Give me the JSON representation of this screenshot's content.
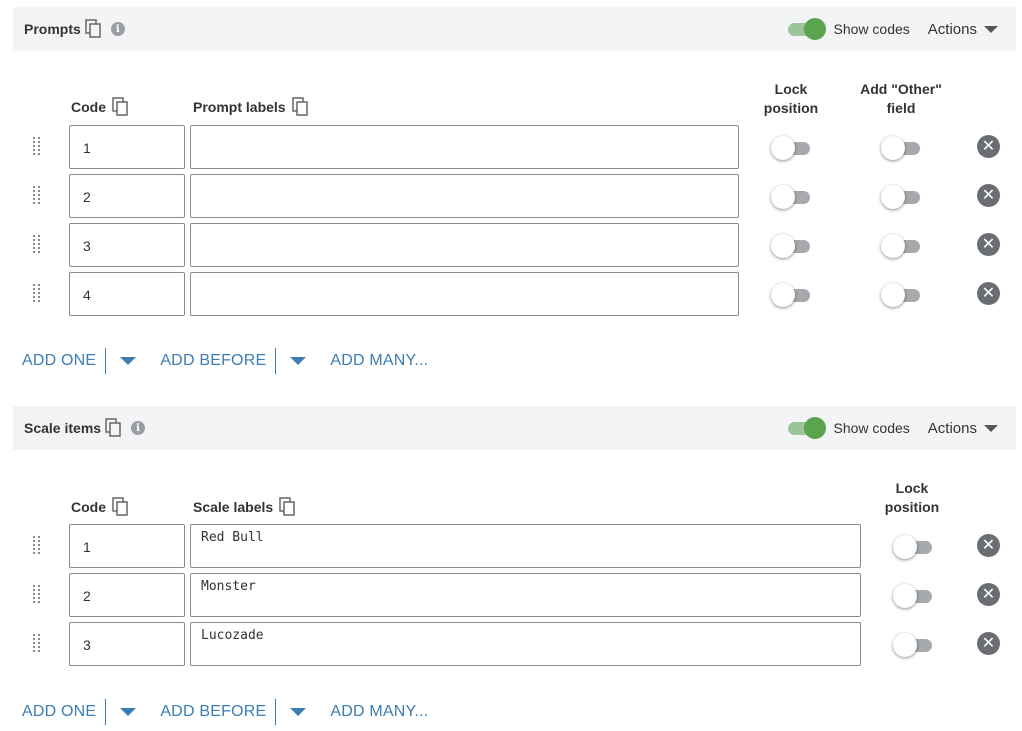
{
  "prompts": {
    "title": "Prompts",
    "show_codes": "Show codes",
    "actions": "Actions",
    "col_code": "Code",
    "col_labels": "Prompt labels",
    "col_lock_1": "Lock",
    "col_lock_2": "position",
    "col_other_1": "Add \"Other\"",
    "col_other_2": "field",
    "rows": [
      {
        "code": "1",
        "label": ""
      },
      {
        "code": "2",
        "label": ""
      },
      {
        "code": "3",
        "label": ""
      },
      {
        "code": "4",
        "label": ""
      }
    ],
    "add_one": "ADD ONE",
    "add_before": "ADD BEFORE",
    "add_many": "ADD MANY..."
  },
  "scale": {
    "title": "Scale items",
    "show_codes": "Show codes",
    "actions": "Actions",
    "col_code": "Code",
    "col_labels": "Scale labels",
    "col_lock_1": "Lock",
    "col_lock_2": "position",
    "rows": [
      {
        "code": "1",
        "label": "Red Bull"
      },
      {
        "code": "2",
        "label": "Monster"
      },
      {
        "code": "3",
        "label": "Lucozade"
      }
    ],
    "add_one": "ADD ONE",
    "add_before": "ADD BEFORE",
    "add_many": "ADD MANY..."
  },
  "icons": {
    "copy": "copy-icon",
    "info": "info-icon",
    "drag": "drag-handle-icon",
    "remove": "remove-circle-icon",
    "caret": "caret-down-icon"
  },
  "colors": {
    "accent_link": "#3d7db3",
    "toggle_on": "#5aa34f",
    "toggle_off_track": "#a6a9ad",
    "header_bg": "#f3f4f6"
  },
  "toggles": {
    "show_codes_prompts": true,
    "show_codes_scale": true
  }
}
